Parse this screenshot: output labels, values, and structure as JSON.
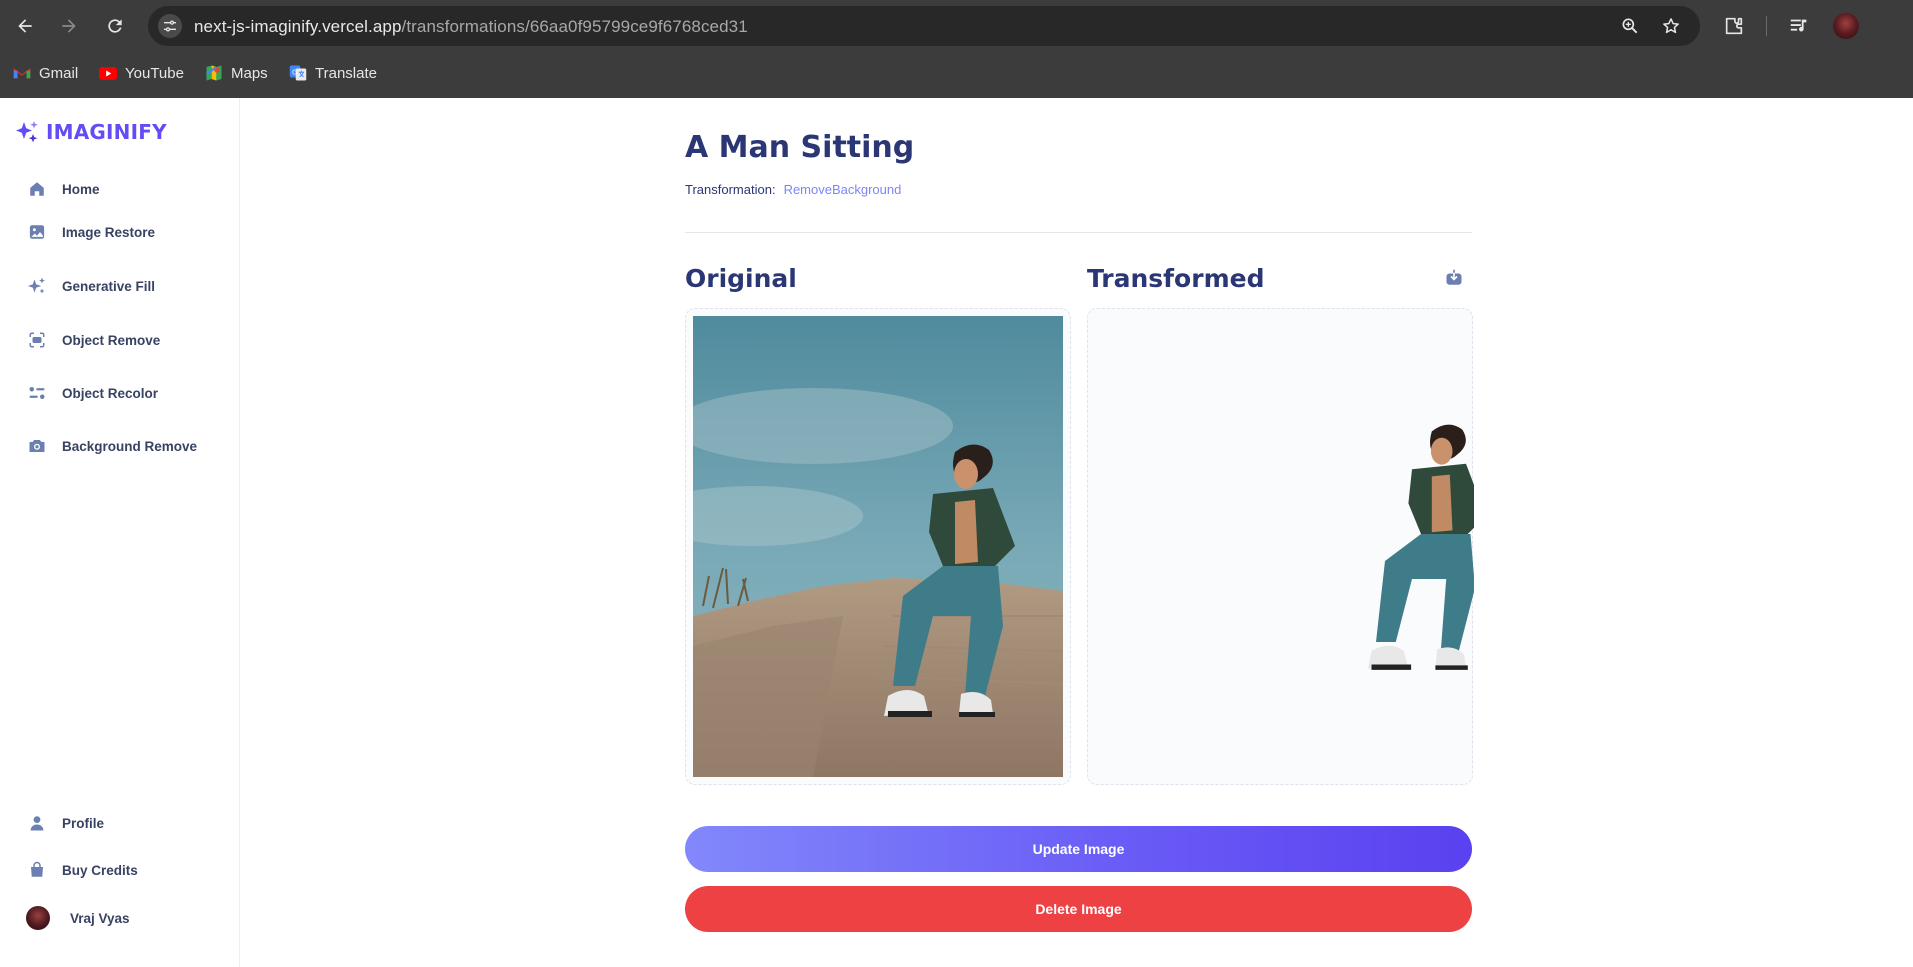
{
  "browser": {
    "url_host": "next-js-imaginify.vercel.app",
    "url_path": "/transformations/66aa0f95799ce9f6768ced31",
    "bookmarks": [
      {
        "label": "Gmail",
        "icon": "gmail-icon"
      },
      {
        "label": "YouTube",
        "icon": "youtube-icon"
      },
      {
        "label": "Maps",
        "icon": "maps-icon"
      },
      {
        "label": "Translate",
        "icon": "translate-icon"
      }
    ]
  },
  "app": {
    "logo_text": "IMAGINIFY",
    "accent_color": "#624cf5",
    "nav": [
      {
        "label": "Home",
        "icon": "home-icon"
      },
      {
        "label": "Image Restore",
        "icon": "image-icon"
      },
      {
        "label": "Generative Fill",
        "icon": "sparkles-icon"
      },
      {
        "label": "Object Remove",
        "icon": "scan-icon"
      },
      {
        "label": "Object Recolor",
        "icon": "filter-icon"
      },
      {
        "label": "Background Remove",
        "icon": "camera-icon"
      }
    ],
    "bottom_nav": [
      {
        "label": "Profile",
        "icon": "profile-icon"
      },
      {
        "label": "Buy Credits",
        "icon": "bag-icon"
      }
    ],
    "user_name": "Vraj Vyas"
  },
  "page": {
    "title": "A Man Sitting",
    "transformation_label": "Transformation:",
    "transformation_value": "RemoveBackground",
    "original_title": "Original",
    "transformed_title": "Transformed",
    "update_button": "Update Image",
    "delete_button": "Delete Image",
    "update_color": "#624cf5",
    "delete_color": "#ee4144"
  }
}
